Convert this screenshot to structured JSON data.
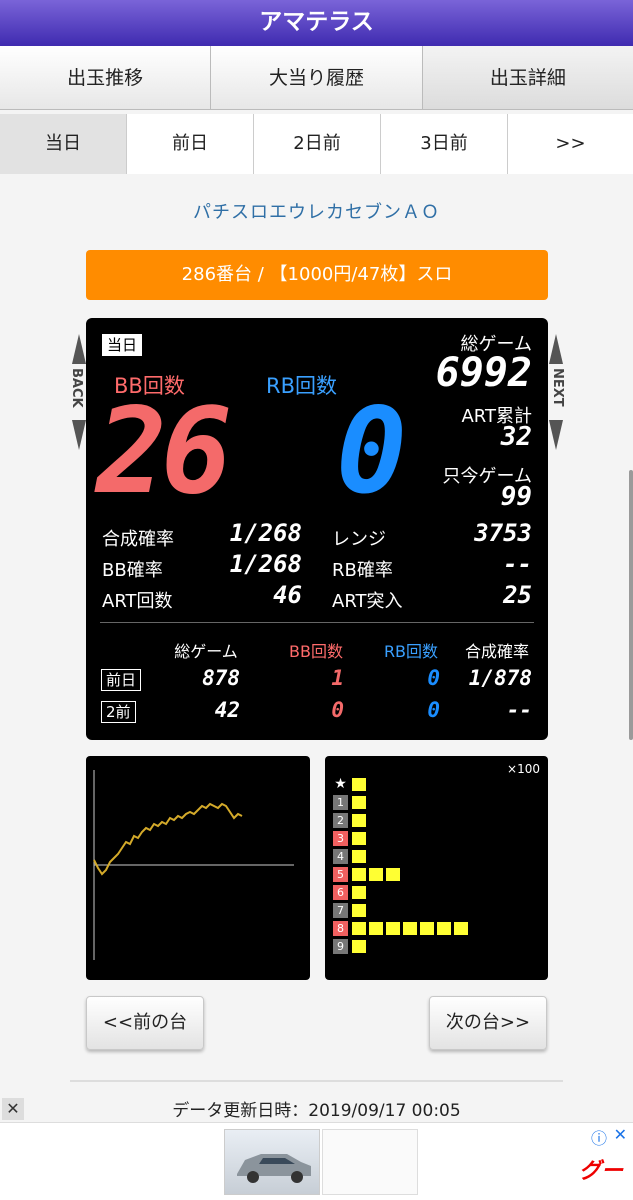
{
  "app": {
    "title": "アマテラス"
  },
  "nav_tabs": [
    {
      "label": "出玉推移"
    },
    {
      "label": "大当り履歴"
    },
    {
      "label": "出玉詳細"
    }
  ],
  "day_tabs": [
    {
      "label": "当日"
    },
    {
      "label": "前日"
    },
    {
      "label": "2日前"
    },
    {
      "label": "3日前"
    },
    {
      "label": ">>"
    }
  ],
  "machine": {
    "name": "パチスロエウレカセブンＡＯ",
    "info": "286番台 / 【1000円/47枚】スロ"
  },
  "side_labels": {
    "back": "BACK",
    "next": "NEXT"
  },
  "today": {
    "badge": "当日",
    "bb_label": "BB回数",
    "rb_label": "RB回数",
    "bb_count": "26",
    "rb_count": "0",
    "total_games_label": "総ゲーム",
    "total_games": "6992",
    "art_total_label": "ART累計",
    "art_total": "32",
    "current_games_label": "只今ゲーム",
    "current_games": "99",
    "combined_rate_label": "合成確率",
    "combined_rate": "1/268",
    "bb_rate_label": "BB確率",
    "bb_rate": "1/268",
    "art_count_label": "ART回数",
    "art_count": "46",
    "range_label": "レンジ",
    "range": "3753",
    "rb_rate_label": "RB確率",
    "rb_rate": "--",
    "art_entry_label": "ART突入",
    "art_entry": "25"
  },
  "history": {
    "headers": {
      "games": "総ゲーム",
      "bb": "BB回数",
      "rb": "RB回数",
      "rate": "合成確率"
    },
    "rows": [
      {
        "label": "前日",
        "games": "878",
        "bb": "1",
        "rb": "0",
        "rate": "1/878"
      },
      {
        "label": "2前",
        "games": "42",
        "bb": "0",
        "rb": "0",
        "rate": "--"
      }
    ]
  },
  "bar_chart": {
    "unit": "×100",
    "star": "★",
    "rows": [
      {
        "num": "★",
        "cells": 1,
        "red": false
      },
      {
        "num": "1",
        "cells": 1,
        "red": false
      },
      {
        "num": "2",
        "cells": 1,
        "red": false
      },
      {
        "num": "3",
        "cells": 1,
        "red": true
      },
      {
        "num": "4",
        "cells": 1,
        "red": false
      },
      {
        "num": "5",
        "cells": 3,
        "red": true
      },
      {
        "num": "6",
        "cells": 1,
        "red": true
      },
      {
        "num": "7",
        "cells": 1,
        "red": false
      },
      {
        "num": "8",
        "cells": 7,
        "red": true
      },
      {
        "num": "9",
        "cells": 1,
        "red": false
      }
    ]
  },
  "buttons": {
    "prev": "<<前の台",
    "next": "次の台>>"
  },
  "footer": {
    "updated": "データ更新日時：2019/09/17 00:05"
  },
  "ad": {
    "close": "✕",
    "info": "ⓘ",
    "x": "✕",
    "logo": "グー"
  },
  "colors": {
    "header_top": "#7a64d8",
    "header_bottom": "#3f2bb0",
    "orange": "#ff8c00",
    "bb_red": "#f46a6a",
    "rb_blue": "#1a8dff",
    "graph_line": "#d4aa2a"
  }
}
